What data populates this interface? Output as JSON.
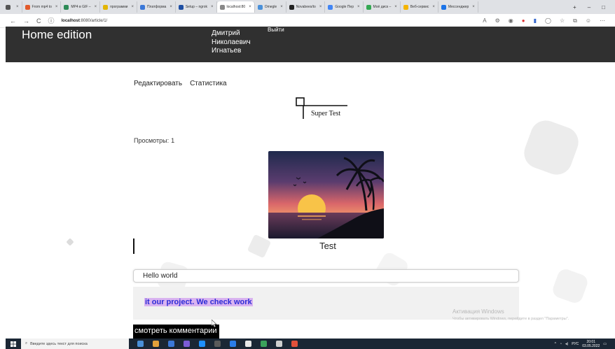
{
  "browser": {
    "tabs": [
      {
        "label": "",
        "color": "#555555"
      },
      {
        "label": "From mp4 to",
        "color": "#e25a2b"
      },
      {
        "label": "MP4 в GIF –",
        "color": "#2e8b57"
      },
      {
        "label": "программи",
        "color": "#e3b505"
      },
      {
        "label": "Платформа",
        "color": "#3b78d8"
      },
      {
        "label": "Setup – ngrok",
        "color": "#1f4fa3"
      },
      {
        "label": "localhost:80",
        "color": "#888888",
        "active": true
      },
      {
        "label": "Omegle",
        "color": "#4a90d9"
      },
      {
        "label": "Novabees/to",
        "color": "#222222"
      },
      {
        "label": "Google Пер",
        "color": "#4285f4"
      },
      {
        "label": "Моё диск –",
        "color": "#34a853"
      },
      {
        "label": "Веб-сервис",
        "color": "#f4b400"
      },
      {
        "label": "Мессенджер",
        "color": "#1a73e8"
      }
    ],
    "new_tab_glyph": "+",
    "minimize_glyph": "–",
    "maximize_glyph": "□",
    "back_glyph": "←",
    "forward_glyph": "→",
    "reload_glyph": "C",
    "info_glyph": "ⓘ",
    "url_host": "localhost",
    "url_rest": ":8080/article/1/"
  },
  "site": {
    "brand": "Home edition",
    "user_name_lines": [
      "Дмитрий",
      "Николаевич",
      "Игнатьев"
    ],
    "logout": "Выйти"
  },
  "article": {
    "edit_label": "Редактировать",
    "stats_label": "Статистика",
    "logo_text": "Super Test",
    "views_label": "Просмотры:",
    "views_count": "1",
    "image_caption": "Test",
    "comment_input_value": "Hello world",
    "comment_text": "it our project. We check work",
    "show_comments_label": "смотреть комментарии"
  },
  "windows_activation": {
    "title": "Активация Windows",
    "subtitle": "Чтобы активировать Windows, перейдите в раздел \"Параметры\"."
  },
  "taskbar": {
    "search_placeholder": "Введите здесь текст для поиска",
    "language": "РУС",
    "time": "20:01",
    "date": "03.05.2022",
    "app_colors": [
      "#4a90d9",
      "#e3a13b",
      "#3b78d8",
      "#7b5cd6",
      "#1e90ff",
      "#5a5a5a",
      "#2b7de9",
      "#e8e8e8",
      "#3ba35b",
      "#cfcfcf",
      "#e2503a"
    ]
  }
}
